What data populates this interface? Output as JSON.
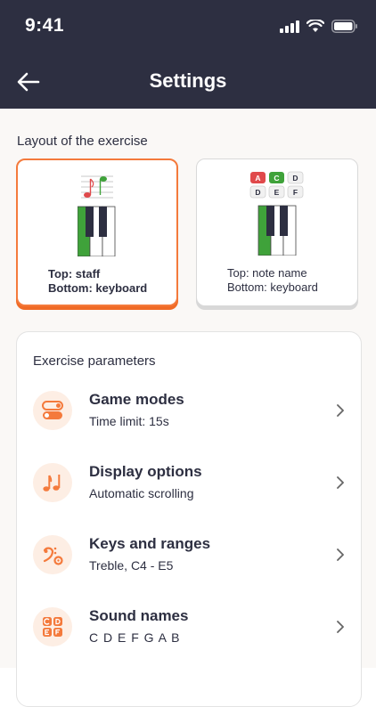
{
  "status": {
    "time": "9:41"
  },
  "header": {
    "title": "Settings"
  },
  "layout": {
    "label": "Layout of the exercise",
    "options": [
      {
        "line1": "Top: staff",
        "line2": "Bottom: keyboard",
        "selected": true
      },
      {
        "line1": "Top: note name",
        "line2": "Bottom: keyboard",
        "selected": false
      }
    ],
    "note_keys": [
      "A",
      "C",
      "D",
      "D",
      "E",
      "F"
    ]
  },
  "params": {
    "title": "Exercise parameters",
    "items": [
      {
        "title": "Game modes",
        "subtitle": "Time limit: 15s",
        "icon": "toggle-icon"
      },
      {
        "title": "Display options",
        "subtitle": "Automatic scrolling",
        "icon": "music-notes-icon"
      },
      {
        "title": "Keys and ranges",
        "subtitle": "Treble, C4 - E5",
        "icon": "bass-clef-gear-icon"
      },
      {
        "title": "Sound names",
        "subtitle": "C D E F G A B",
        "icon": "note-letters-icon"
      }
    ]
  },
  "colors": {
    "accent": "#f47a3c",
    "header_bg": "#2d2f41",
    "green": "#3fa23a",
    "red": "#e0494b"
  }
}
